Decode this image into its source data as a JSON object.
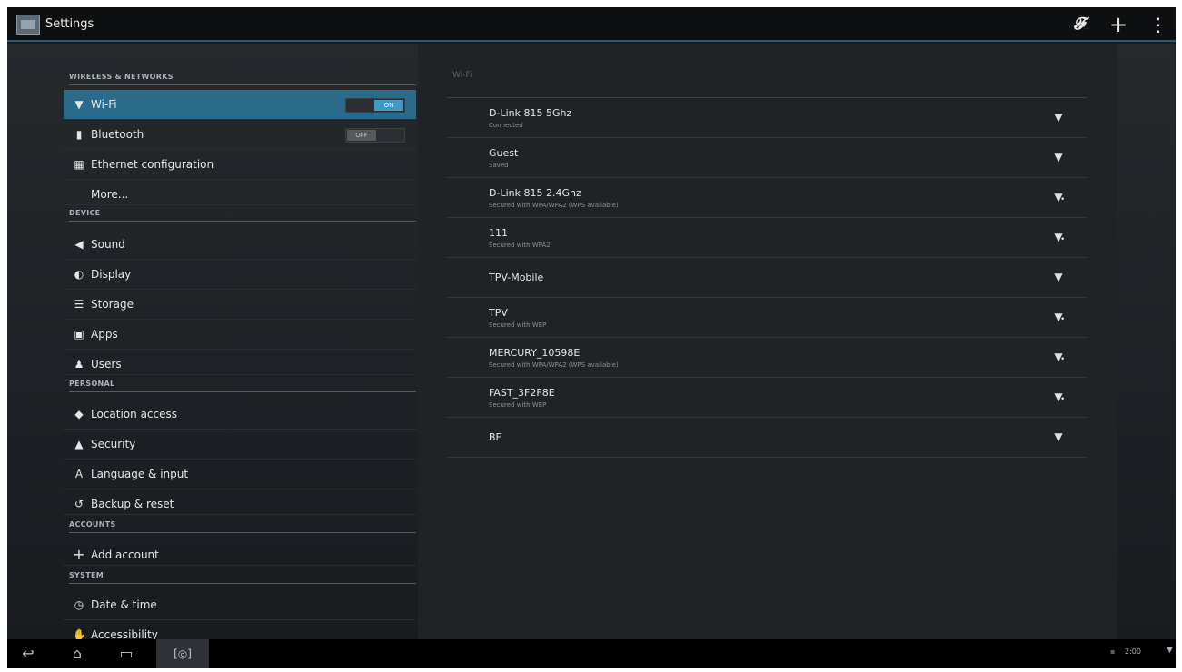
{
  "actionbar": {
    "title": "Settings",
    "wps_glyph": "𝓕",
    "add_glyph": "+",
    "overflow_glyph": "⋮"
  },
  "sidebar": {
    "sections": [
      {
        "header": "WIRELESS & NETWORKS"
      },
      {
        "header": "DEVICE"
      },
      {
        "header": "PERSONAL"
      },
      {
        "header": "ACCOUNTS"
      },
      {
        "header": "SYSTEM"
      }
    ],
    "items": [
      {
        "label": "Wi-Fi",
        "icon": "wifi-icon",
        "glyph": "▼",
        "toggle": "ON",
        "selected": true
      },
      {
        "label": "Bluetooth",
        "icon": "bluetooth-icon",
        "glyph": "▮",
        "toggle": "OFF"
      },
      {
        "label": "Ethernet configuration",
        "icon": "ethernet-icon",
        "glyph": "▦"
      },
      {
        "label": "More...",
        "icon": "",
        "glyph": ""
      },
      {
        "label": "Sound",
        "icon": "speaker-icon",
        "glyph": "◀"
      },
      {
        "label": "Display",
        "icon": "display-icon",
        "glyph": "◐"
      },
      {
        "label": "Storage",
        "icon": "storage-icon",
        "glyph": "☰"
      },
      {
        "label": "Apps",
        "icon": "apps-icon",
        "glyph": "▣"
      },
      {
        "label": "Users",
        "icon": "users-icon",
        "glyph": "♟"
      },
      {
        "label": "Location access",
        "icon": "location-icon",
        "glyph": "◆"
      },
      {
        "label": "Security",
        "icon": "lock-icon",
        "glyph": "▲"
      },
      {
        "label": "Language & input",
        "icon": "keyboard-icon",
        "glyph": "A"
      },
      {
        "label": "Backup & reset",
        "icon": "backup-icon",
        "glyph": "↺"
      },
      {
        "label": "Add account",
        "icon": "plus-icon",
        "glyph": "+"
      },
      {
        "label": "Date & time",
        "icon": "clock-icon",
        "glyph": "◷"
      },
      {
        "label": "Accessibility",
        "icon": "hand-icon",
        "glyph": "✋"
      }
    ]
  },
  "wifi": {
    "header": "Wi-Fi",
    "networks": [
      {
        "name": "D-Link 815 5Ghz",
        "status": "Connected",
        "signal_icon": "wifi-signal-icon",
        "locked": false
      },
      {
        "name": "Guest",
        "status": "Saved",
        "signal_icon": "wifi-signal-icon",
        "locked": false
      },
      {
        "name": "D-Link 815 2.4Ghz",
        "status": "Secured with WPA/WPA2 (WPS available)",
        "signal_icon": "wifi-lock-icon",
        "locked": true
      },
      {
        "name": "111",
        "status": "Secured with WPA2",
        "signal_icon": "wifi-lock-icon",
        "locked": true
      },
      {
        "name": "TPV-Mobile",
        "status": "",
        "signal_icon": "wifi-signal-icon",
        "locked": false
      },
      {
        "name": "TPV",
        "status": "Secured with WEP",
        "signal_icon": "wifi-lock-icon",
        "locked": true
      },
      {
        "name": "MERCURY_10598E",
        "status": "Secured with WPA/WPA2 (WPS available)",
        "signal_icon": "wifi-lock-icon",
        "locked": true
      },
      {
        "name": "FAST_3F2F8E",
        "status": "Secured with WEP",
        "signal_icon": "wifi-lock-icon",
        "locked": true
      },
      {
        "name": "BF",
        "status": "",
        "signal_icon": "wifi-signal-icon",
        "locked": false
      }
    ]
  },
  "navbar": {
    "back_glyph": "↩",
    "home_glyph": "⌂",
    "recent_glyph": "▭",
    "screenshot_glyph": "[◎]",
    "time": "2:00",
    "wifi_glyph": "▼"
  },
  "colors": {
    "accent": "#2a6b8c",
    "toggle_on": "#3f9bc6",
    "background": "#1a1d20"
  }
}
